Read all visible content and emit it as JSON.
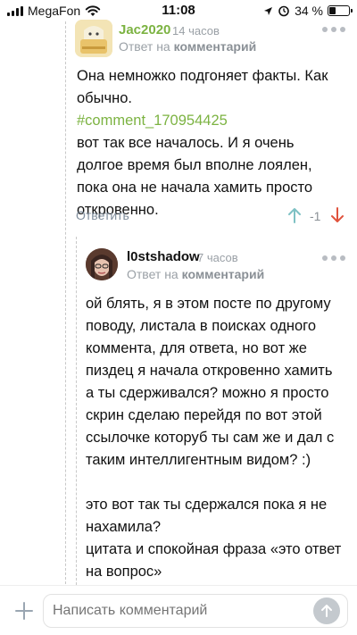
{
  "status_bar": {
    "carrier": "MegaFon",
    "time": "11:08",
    "battery": "34 %",
    "battery_level": 0.34
  },
  "comment_1": {
    "author": "Jac2020",
    "time": "14 часов",
    "reply_prefix": "Ответ на",
    "reply_target": "комментарий",
    "line_1": "Она немножко подгоняет факты. Как обычно.",
    "link": "#comment_170954425",
    "line_2": "вот так все началось. И я очень долгое время был вполне лоялен, пока она не начала хамить просто откровенно.",
    "reply_button": "Ответить",
    "score": "-1"
  },
  "comment_2": {
    "author": "l0stshadow",
    "time": "7 часов",
    "reply_prefix": "Ответ на",
    "reply_target": "комментарий",
    "paragraph_1": "ой блять, я в этом посте по другому поводу, листала в поисках одного коммента, для ответа, но вот же пиздец я начала откровенно хамить а ты сдерживался? можно я просто скрин сделаю перейдя по вот этой ссылочке которуб ты сам же и дал с таким интеллигентным видом? :)",
    "paragraph_2": "это вот так ты сдержался пока я не нахамила?\nцитата и спокойная фраза «это ответ на вопрос»"
  },
  "composer": {
    "placeholder": "Написать комментарий"
  },
  "icons": {
    "plus": "plus-icon",
    "send": "arrow-up-icon",
    "vote_up": "arrow-up-icon",
    "vote_down": "arrow-down-icon",
    "more": "more-dots-icon"
  },
  "colors": {
    "accent_green": "#7cb342",
    "vote_up": "#7ec1c4",
    "vote_down": "#e0533d",
    "muted": "#9aa0a6"
  }
}
